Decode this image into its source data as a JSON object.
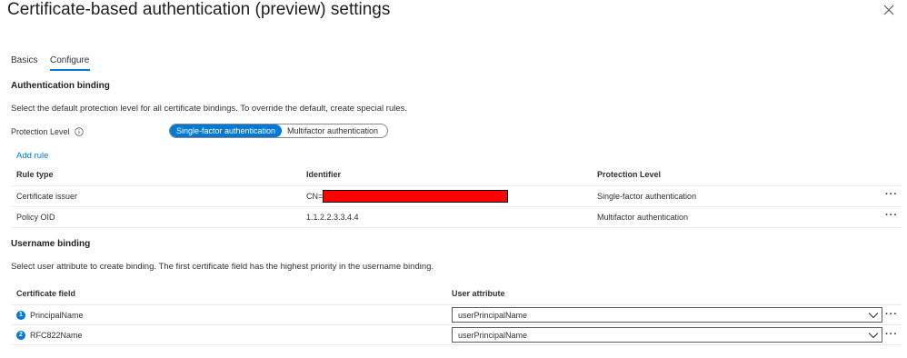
{
  "header": {
    "title": "Certificate-based authentication (preview) settings",
    "more": "···"
  },
  "tabs": [
    {
      "label": "Basics",
      "selected": false
    },
    {
      "label": "Configure",
      "selected": true
    }
  ],
  "auth_binding": {
    "heading": "Authentication binding",
    "description": "Select the default protection level for all certificate bindings. To override the default, create special rules.",
    "protection_label": "Protection Level",
    "options": [
      "Single-factor authentication",
      "Multifactor authentication"
    ],
    "selected_option": "Single-factor authentication",
    "add_rule": "Add rule",
    "columns": [
      "Rule type",
      "Identifier",
      "Protection Level"
    ],
    "rows": [
      {
        "rule_type": "Certificate issuer",
        "identifier": "CN=",
        "protection": "Single-factor authentication",
        "more": "···"
      },
      {
        "rule_type": "Policy OID",
        "identifier": "1.1.2.2.3.3.4.4",
        "protection": "Multifactor authentication",
        "more": "···"
      }
    ]
  },
  "username_binding": {
    "heading": "Username binding",
    "description": "Select user attribute to create binding. The first certificate field has the highest priority in the username binding.",
    "columns": [
      "Certificate field",
      "User attribute"
    ],
    "rows": [
      {
        "num": "1",
        "field": "PrincipalName",
        "attribute": "userPrincipalName",
        "more": "···"
      },
      {
        "num": "2",
        "field": "RFC822Name",
        "attribute": "userPrincipalName",
        "more": "···"
      }
    ]
  },
  "colors": {
    "accent": "#0078d4",
    "redaction": "#ff0000"
  }
}
